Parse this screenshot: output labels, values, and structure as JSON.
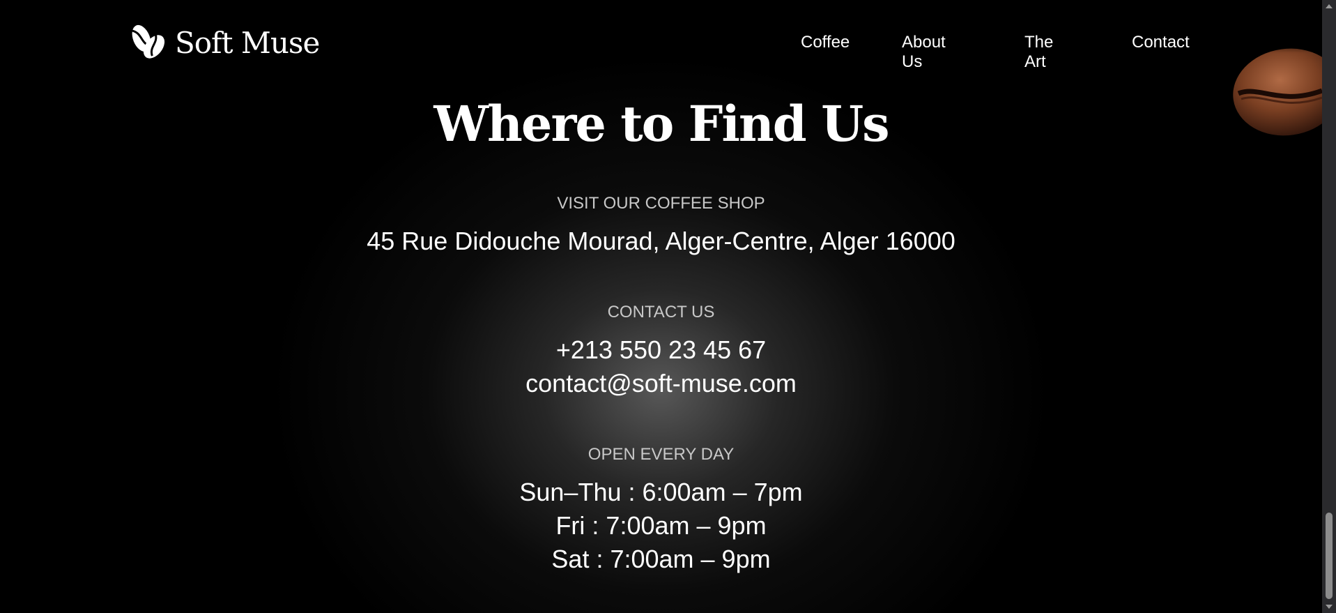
{
  "brand": {
    "name": "Soft Muse",
    "icon": "coffee-beans-logo-icon"
  },
  "nav": {
    "items": [
      {
        "label": "Coffee"
      },
      {
        "label": "About Us"
      },
      {
        "label": "The Art"
      },
      {
        "label": "Contact"
      }
    ]
  },
  "section": {
    "title": "Where to Find Us",
    "visit": {
      "label": "VISIT OUR COFFEE SHOP",
      "address": "45 Rue Didouche Mourad, Alger-Centre, Alger 16000"
    },
    "contact": {
      "label": "CONTACT US",
      "phone": "+213 550 23 45 67",
      "email": "contact@soft-muse.com"
    },
    "hours": {
      "label": "OPEN EVERY DAY",
      "lines": [
        "Sun–Thu : 6:00am – 7pm",
        "Fri : 7:00am – 9pm",
        "Sat : 7:00am – 9pm"
      ]
    }
  },
  "decor": {
    "image": "coffee-bean-image"
  },
  "scrollbar": {
    "scroll_fraction": 0.95
  }
}
